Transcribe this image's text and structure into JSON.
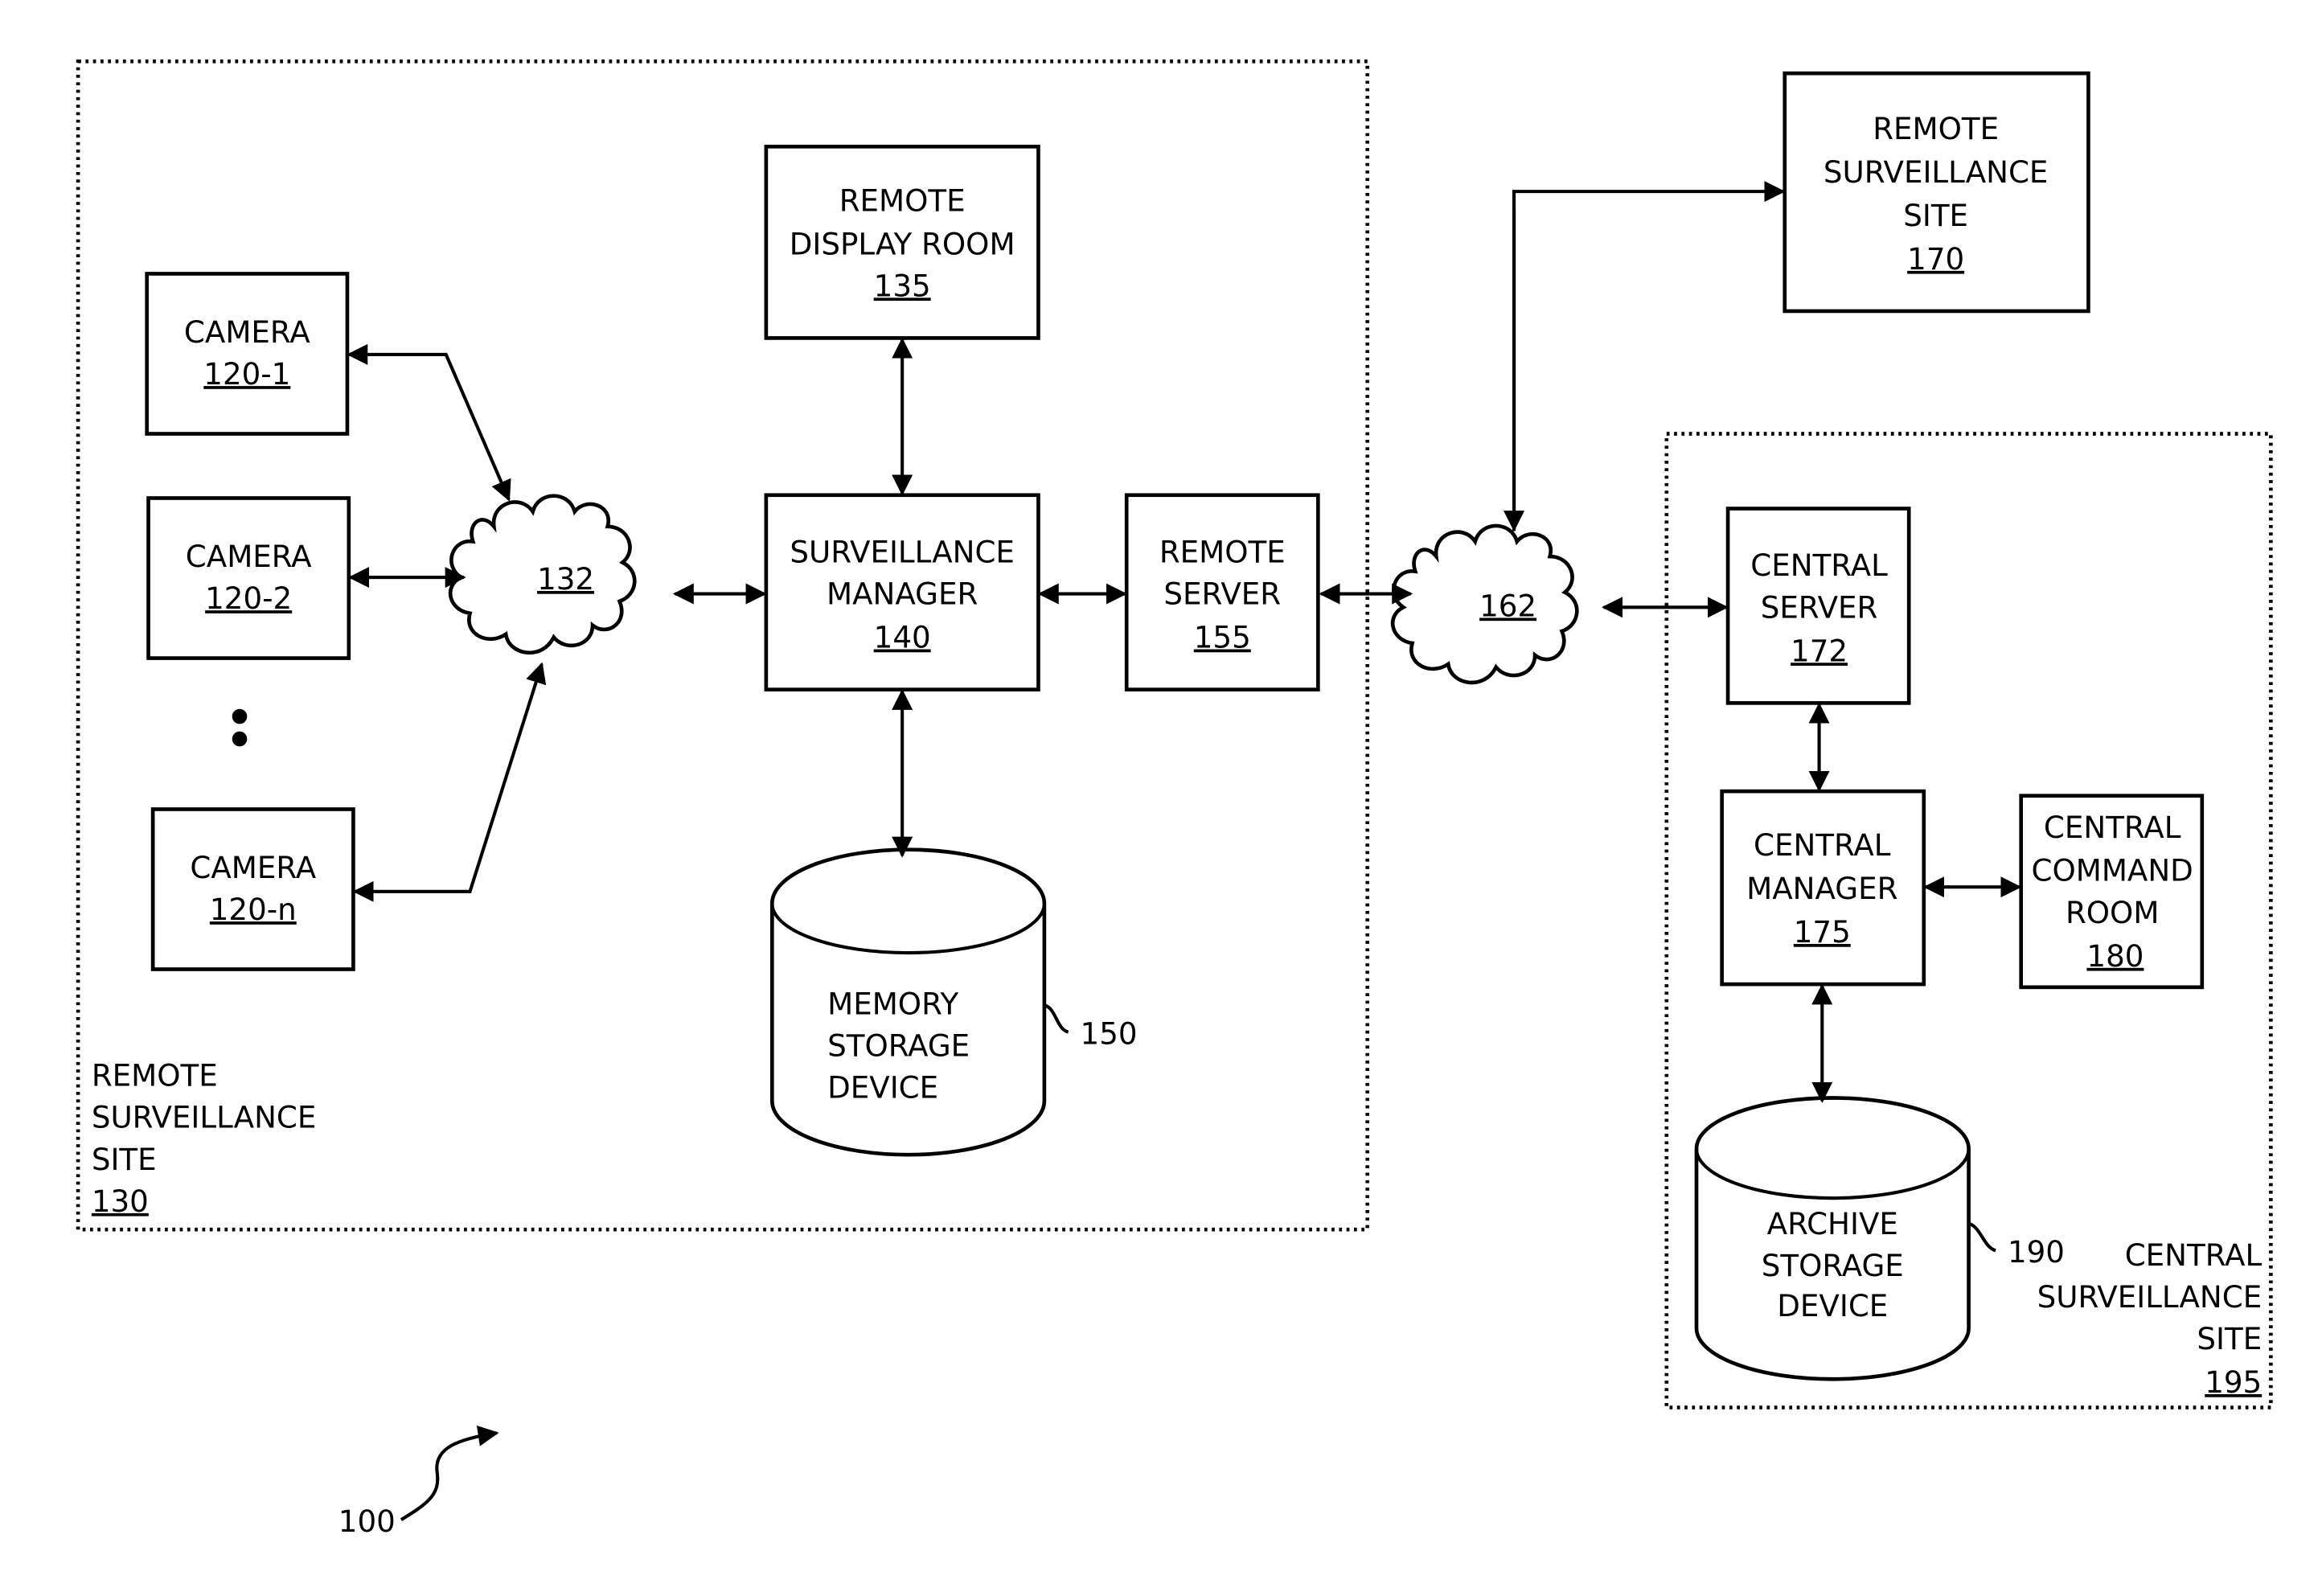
{
  "figure": {
    "ref": "100"
  },
  "sites": {
    "remote_site": {
      "lines": [
        "REMOTE",
        "SURVEILLANCE",
        "SITE"
      ],
      "ref": "130"
    },
    "central_site": {
      "lines": [
        "CENTRAL",
        "SURVEILLANCE",
        "SITE"
      ],
      "ref": "195"
    }
  },
  "nodes": {
    "camera1": {
      "lines": [
        "CAMERA"
      ],
      "ref": "120-1"
    },
    "camera2": {
      "lines": [
        "CAMERA"
      ],
      "ref": "120-2"
    },
    "cameran": {
      "lines": [
        "CAMERA"
      ],
      "ref": "120-n"
    },
    "network132": {
      "ref": "132"
    },
    "display_room": {
      "lines": [
        "REMOTE",
        "DISPLAY ROOM"
      ],
      "ref": "135"
    },
    "surv_manager": {
      "lines": [
        "SURVEILLANCE",
        "MANAGER"
      ],
      "ref": "140"
    },
    "remote_server": {
      "lines": [
        "REMOTE",
        "SERVER"
      ],
      "ref": "155"
    },
    "memory_storage": {
      "lines": [
        "MEMORY",
        "STORAGE",
        "DEVICE"
      ],
      "ref": "150"
    },
    "network162": {
      "ref": "162"
    },
    "remote_site170": {
      "lines": [
        "REMOTE",
        "SURVEILLANCE",
        "SITE"
      ],
      "ref": "170"
    },
    "central_server": {
      "lines": [
        "CENTRAL",
        "SERVER"
      ],
      "ref": "172"
    },
    "central_manager": {
      "lines": [
        "CENTRAL",
        "MANAGER"
      ],
      "ref": "175"
    },
    "command_room": {
      "lines": [
        "CENTRAL",
        "COMMAND",
        "ROOM"
      ],
      "ref": "180"
    },
    "archive_storage": {
      "lines": [
        "ARCHIVE",
        "STORAGE",
        "DEVICE"
      ],
      "ref": "190"
    }
  }
}
